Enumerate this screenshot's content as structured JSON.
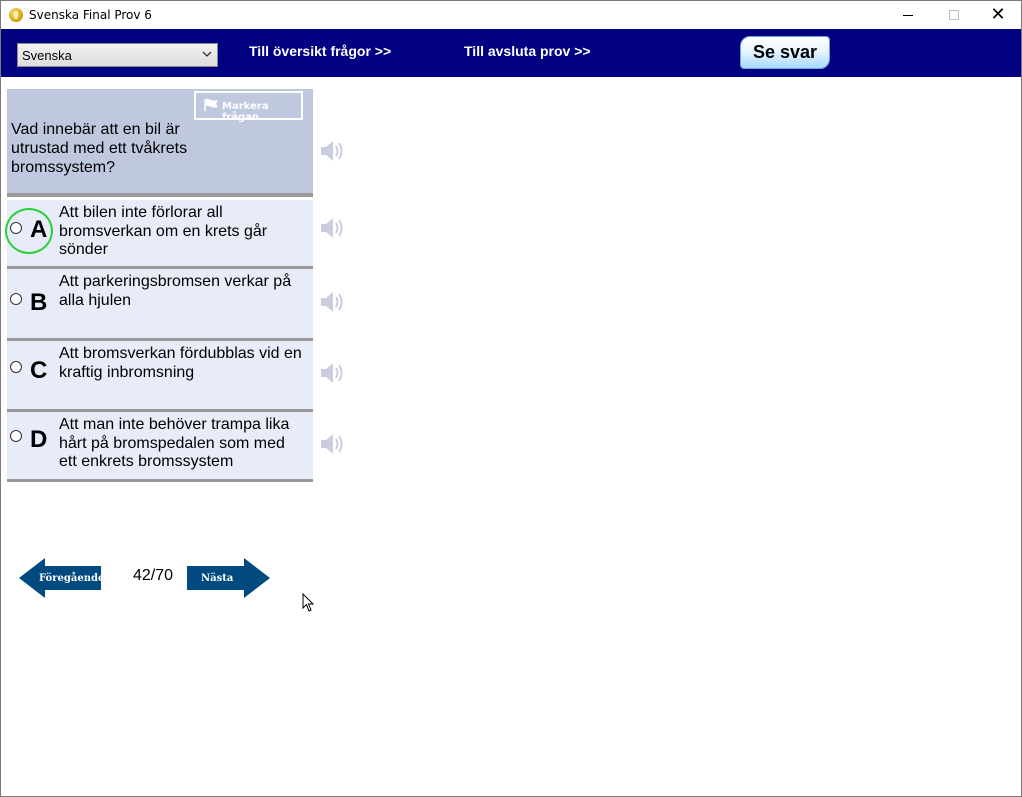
{
  "window": {
    "title": "Svenska Final Prov 6",
    "minimize_icon": "minimize-icon",
    "maximize_icon": "maximize-icon",
    "close_label": "✕"
  },
  "toolbar": {
    "language_value": "Svenska",
    "overview_link": "Till översikt frågor >>",
    "finish_link": "Till avsluta prov  >>",
    "see_answer_button": "Se svar",
    "background_color": "#000080"
  },
  "question": {
    "mark_button": "Markera frågan",
    "text": "Vad innebär att en bil är utrustad med ett tvåkrets bromssystem?"
  },
  "answers": [
    {
      "letter": "A",
      "text": "Att bilen inte förlorar all bromsverkan om en krets går sönder",
      "highlighted": true
    },
    {
      "letter": "B",
      "text": "Att parkeringsbromsen verkar på alla hjulen",
      "highlighted": false
    },
    {
      "letter": "C",
      "text": "Att bromsverkan fördubblas vid en kraftig inbromsning",
      "highlighted": false
    },
    {
      "letter": "D",
      "text": "Att man inte behöver trampa lika hårt på bromspedalen som med ett enkrets bromssystem",
      "highlighted": false
    }
  ],
  "navigation": {
    "previous_label": "Föregående",
    "next_label": "Nästa",
    "counter": "42/70",
    "arrow_color": "#004a80"
  },
  "colors": {
    "question_panel": "#c0c8e0",
    "answer_panel": "#e8ecf8",
    "highlight_ring": "#27d13a"
  }
}
